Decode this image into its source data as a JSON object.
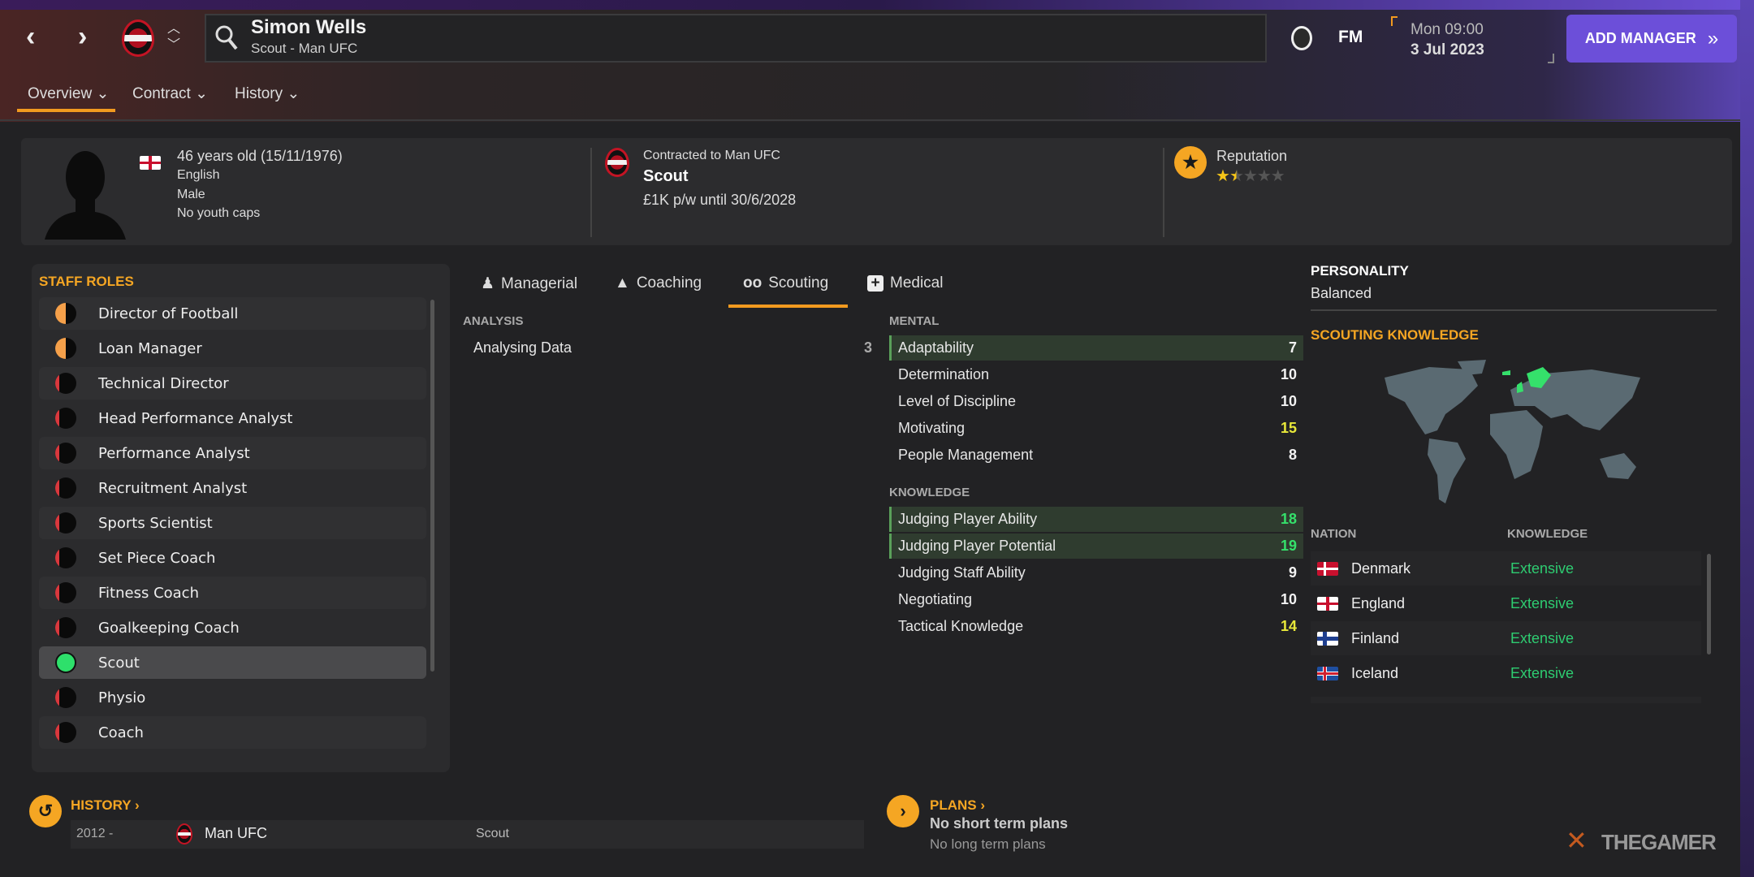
{
  "header": {
    "name": "Simon Wells",
    "subtitle": "Scout - Man UFC",
    "fm_label": "FM",
    "time": "Mon 09:00",
    "date": "3 Jul 2023",
    "add_manager": "ADD MANAGER",
    "add_manager_icon": "»"
  },
  "tabs": [
    {
      "label": "Overview ⌄"
    },
    {
      "label": "Contract ⌄"
    },
    {
      "label": "History ⌄"
    }
  ],
  "profile": {
    "age": "46 years old (15/11/1976)",
    "nationality": "English",
    "gender": "Male",
    "caps": "No youth caps",
    "contracted": "Contracted to Man UFC",
    "role": "Scout",
    "wage": "£1K p/w until 30/6/2028",
    "reputation_label": "Reputation",
    "reputation_stars": 1.5,
    "reputation_max": 5
  },
  "staff_roles": {
    "title": "STAFF ROLES",
    "items": [
      {
        "label": "Director of Football",
        "level": "orange"
      },
      {
        "label": "Loan Manager",
        "level": "orange"
      },
      {
        "label": "Technical Director",
        "level": "red"
      },
      {
        "label": "Head Performance Analyst",
        "level": "red"
      },
      {
        "label": "Performance Analyst",
        "level": "red"
      },
      {
        "label": "Recruitment Analyst",
        "level": "red"
      },
      {
        "label": "Sports Scientist",
        "level": "red"
      },
      {
        "label": "Set Piece Coach",
        "level": "red"
      },
      {
        "label": "Fitness Coach",
        "level": "red"
      },
      {
        "label": "Goalkeeping Coach",
        "level": "red"
      },
      {
        "label": "Scout",
        "level": "green",
        "selected": true
      },
      {
        "label": "Physio",
        "level": "red"
      },
      {
        "label": "Coach",
        "level": "red"
      }
    ]
  },
  "attr_tabs": [
    {
      "label": "Managerial"
    },
    {
      "label": "Coaching"
    },
    {
      "label": "Scouting"
    },
    {
      "label": "Medical"
    }
  ],
  "analysis": {
    "title": "ANALYSIS",
    "items": [
      {
        "label": "Analysing Data",
        "value": "3"
      }
    ]
  },
  "mental": {
    "title": "MENTAL",
    "items": [
      {
        "label": "Adaptability",
        "value": "7",
        "hl": true
      },
      {
        "label": "Determination",
        "value": "10"
      },
      {
        "label": "Level of Discipline",
        "value": "10"
      },
      {
        "label": "Motivating",
        "value": "15"
      },
      {
        "label": "People Management",
        "value": "8"
      }
    ]
  },
  "knowledge": {
    "title": "KNOWLEDGE",
    "items": [
      {
        "label": "Judging Player Ability",
        "value": "18",
        "hl": true
      },
      {
        "label": "Judging Player Potential",
        "value": "19",
        "hl": true
      },
      {
        "label": "Judging Staff Ability",
        "value": "9"
      },
      {
        "label": "Negotiating",
        "value": "10"
      },
      {
        "label": "Tactical Knowledge",
        "value": "14"
      }
    ]
  },
  "personality": {
    "title": "PERSONALITY",
    "value": "Balanced"
  },
  "scouting_knowledge": {
    "title": "SCOUTING KNOWLEDGE",
    "col_nation": "NATION",
    "col_knowledge": "KNOWLEDGE",
    "rows": [
      {
        "nation": "Denmark",
        "knowledge": "Extensive"
      },
      {
        "nation": "England",
        "knowledge": "Extensive"
      },
      {
        "nation": "Finland",
        "knowledge": "Extensive"
      },
      {
        "nation": "Iceland",
        "knowledge": "Extensive"
      }
    ]
  },
  "history": {
    "title": "HISTORY ›",
    "rows": [
      {
        "years": "2012 -",
        "club": "Man UFC",
        "role": "Scout"
      }
    ]
  },
  "plans": {
    "title": "PLANS ›",
    "short": "No short term plans",
    "long": "No long term plans"
  },
  "watermark": "THEGAMER",
  "colors": {
    "accent": "#f5a623",
    "button": "#6c4fd9",
    "good": "#2ecc71",
    "high": "#e8e83a",
    "excellent": "#35e06b"
  }
}
